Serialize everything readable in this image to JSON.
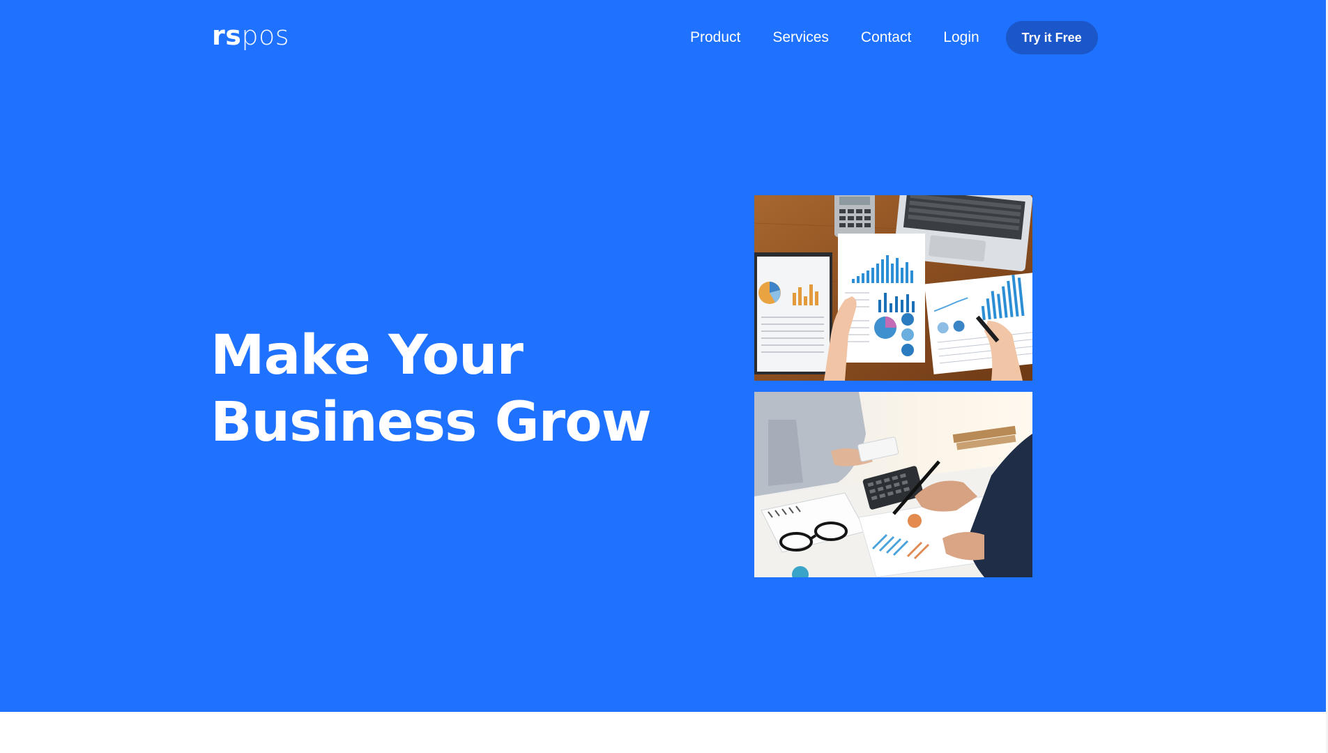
{
  "brand": {
    "logo_bold": "rs",
    "logo_light": "pos"
  },
  "nav": {
    "items": [
      {
        "label": "Product"
      },
      {
        "label": "Services"
      },
      {
        "label": "Contact"
      },
      {
        "label": "Login"
      }
    ],
    "cta_label": "Try it Free"
  },
  "hero": {
    "headline_line1": "Make Your",
    "headline_line2": "Business Grow"
  },
  "colors": {
    "hero_background": "#1f71ff",
    "cta_background": "#1b57c9",
    "text": "#ffffff",
    "page_background": "#ffffff"
  }
}
